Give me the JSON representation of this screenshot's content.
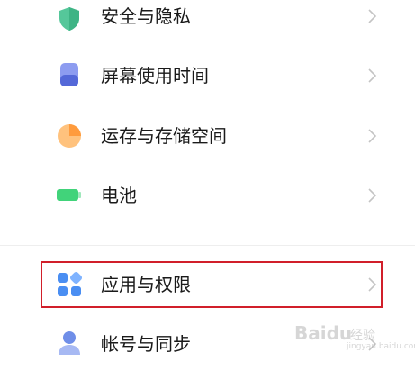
{
  "settings": {
    "items": [
      {
        "label": "安全与隐私",
        "icon": "shield-icon",
        "color": "#55c79a"
      },
      {
        "label": "屏幕使用时间",
        "icon": "hourglass-icon",
        "color": "#6d7fe0"
      },
      {
        "label": "运存与存储空间",
        "icon": "storage-pie-icon",
        "color": "#ffad55"
      },
      {
        "label": "电池",
        "icon": "battery-icon",
        "color": "#41d37a"
      },
      {
        "label": "应用与权限",
        "icon": "apps-icon",
        "color": "#4a8ef2"
      },
      {
        "label": "帐号与同步",
        "icon": "account-icon",
        "color": "#6f8ee8"
      }
    ]
  },
  "highlight_color": "#d11f2a",
  "watermark": {
    "brand": "Baidu",
    "sub": "经验",
    "url": "jingyan.baidu.com"
  }
}
